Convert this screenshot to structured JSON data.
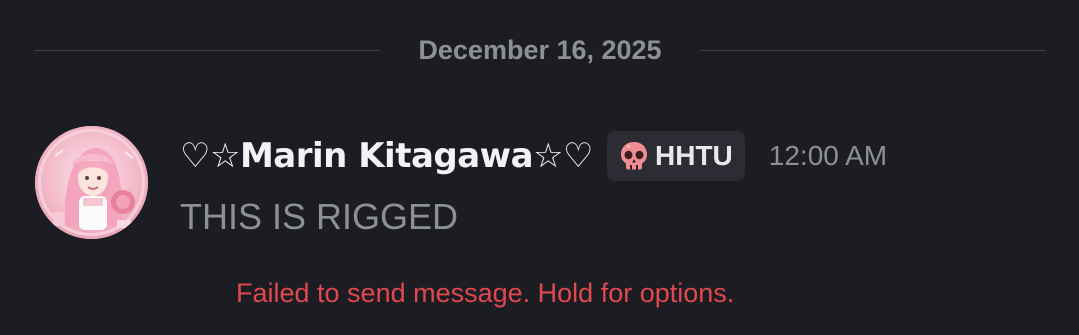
{
  "date_divider": {
    "label": "December 16, 2025"
  },
  "message": {
    "author": {
      "name": "♡☆Marin Kitagawa☆♡",
      "avatar_icon": "avatar-image"
    },
    "tag": {
      "icon": "skull-icon",
      "label": "HHTU"
    },
    "timestamp": "12:00 AM",
    "content": "THIS IS RIGGED",
    "status": "Failed to send message. Hold for options."
  },
  "colors": {
    "background": "#1c1d22",
    "muted_text": "#8d8f97",
    "username": "#f2f3f5",
    "tag_background": "#2c2d34",
    "error": "#e0474f",
    "skull": "#f08d93"
  }
}
